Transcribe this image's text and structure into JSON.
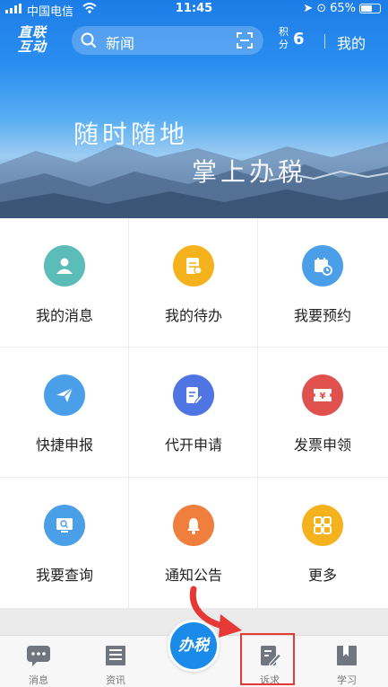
{
  "status_bar": {
    "carrier": "中国电信",
    "time": "11:45",
    "battery": "65%",
    "battery_level": 0.65
  },
  "header": {
    "logo_line1": "直联",
    "logo_line2": "互动",
    "search_text": "新闻",
    "points_label": "积分",
    "points_value": "6",
    "mine_label": "我的"
  },
  "banner": {
    "slogan_line1": "随时随地",
    "slogan_line2": "掌上办税"
  },
  "services": [
    {
      "label": "我的消息",
      "icon": "user-icon",
      "color": "#5cbcb8"
    },
    {
      "label": "我的待办",
      "icon": "document-icon",
      "color": "#f4b21d"
    },
    {
      "label": "我要预约",
      "icon": "calendar-clock-icon",
      "color": "#4a9fe8"
    },
    {
      "label": "快捷申报",
      "icon": "paper-plane-icon",
      "color": "#4a9fe8"
    },
    {
      "label": "代开申请",
      "icon": "edit-doc-icon",
      "color": "#4f74e3"
    },
    {
      "label": "发票申领",
      "icon": "ticket-icon",
      "color": "#e0514e"
    },
    {
      "label": "我要查询",
      "icon": "monitor-search-icon",
      "color": "#4a9fe8"
    },
    {
      "label": "通知公告",
      "icon": "bell-icon",
      "color": "#f07e3c"
    },
    {
      "label": "更多",
      "icon": "grid-icon",
      "color": "#f4b21d"
    }
  ],
  "tabbar": {
    "messages": "消息",
    "news": "资讯",
    "center": "办税",
    "appeal": "诉求",
    "study": "学习"
  }
}
